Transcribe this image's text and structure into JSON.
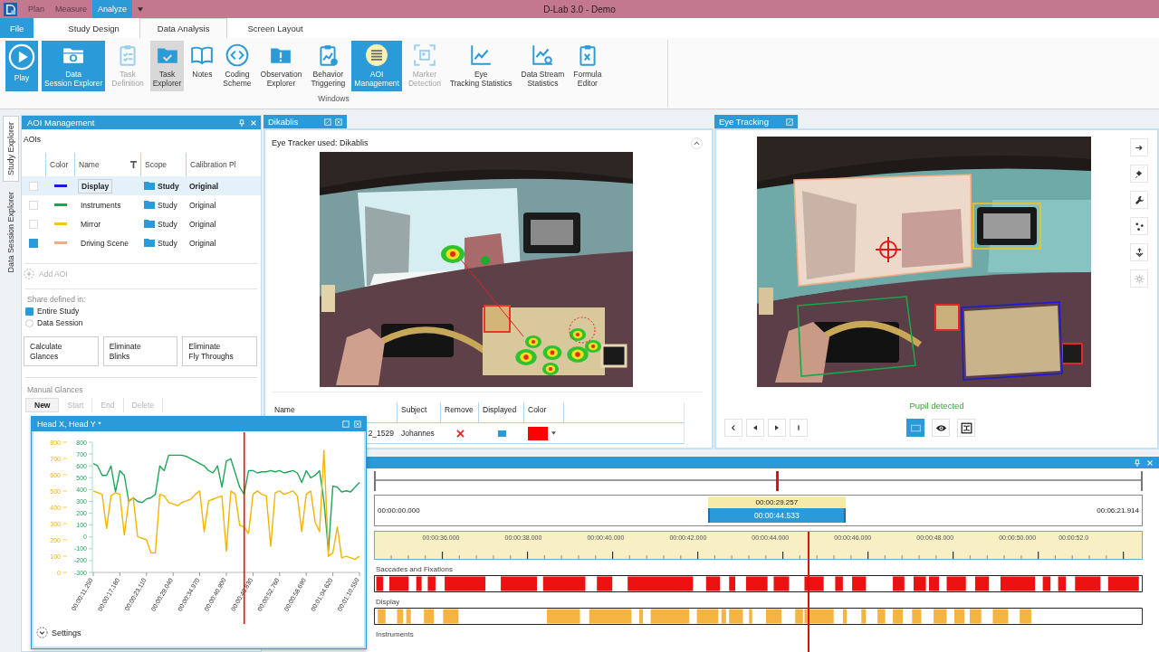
{
  "title_bar": {
    "phases": [
      {
        "label": "Plan",
        "selected": false
      },
      {
        "label": "Measure",
        "selected": false
      },
      {
        "label": "Analyze",
        "selected": true
      }
    ],
    "title": "D-Lab 3.0 - Demo"
  },
  "ribbon_tabs": [
    {
      "label": "File",
      "kind": "file",
      "selected": false
    },
    {
      "label": "Study Design",
      "kind": "tab",
      "selected": false
    },
    {
      "label": "Data Analysis",
      "kind": "tab",
      "selected": true
    },
    {
      "label": "Screen Layout",
      "kind": "tab",
      "selected": false
    }
  ],
  "ribbon": {
    "buttons": [
      {
        "label": "Play",
        "selected": true,
        "pressed": false,
        "disabled": false
      },
      {
        "label": "Data\nSession Explorer",
        "selected": true,
        "pressed": false,
        "disabled": false
      },
      {
        "label": "Task\nDefinition",
        "selected": false,
        "pressed": false,
        "disabled": true
      },
      {
        "label": "Task\nExplorer",
        "selected": false,
        "pressed": true,
        "disabled": false
      },
      {
        "label": "Notes",
        "selected": false,
        "pressed": false,
        "disabled": false
      },
      {
        "label": "Coding\nScheme",
        "selected": false,
        "pressed": false,
        "disabled": false
      },
      {
        "label": "Observation\nExplorer",
        "selected": false,
        "pressed": false,
        "disabled": false
      },
      {
        "label": "Behavior\nTriggering",
        "selected": false,
        "pressed": false,
        "disabled": false
      },
      {
        "label": "AOI\nManagement",
        "selected": true,
        "pressed": false,
        "disabled": false
      },
      {
        "label": "Marker\nDetection",
        "selected": false,
        "pressed": false,
        "disabled": true
      },
      {
        "label": "Eye\nTracking Statistics",
        "selected": false,
        "pressed": false,
        "disabled": false
      },
      {
        "label": "Data Stream\nStatistics",
        "selected": false,
        "pressed": false,
        "disabled": false
      },
      {
        "label": "Formula\nEditor",
        "selected": false,
        "pressed": false,
        "disabled": false
      }
    ],
    "group_label": "Windows"
  },
  "side_tabs": [
    {
      "label": "Study Explorer",
      "selected": true
    },
    {
      "label": "Data Session Explorer",
      "selected": false
    }
  ],
  "aoi_panel": {
    "title": "AOI Management",
    "section_label": "AOIs",
    "columns": [
      "Color",
      "Name",
      "Scope",
      "Calibration Pl"
    ],
    "rows": [
      {
        "checked": false,
        "color": "#1a1adb",
        "name": "Display",
        "scope": "Study",
        "calibration": "Original",
        "selected": true
      },
      {
        "checked": false,
        "color": "#1aa64a",
        "name": "Instruments",
        "scope": "Study",
        "calibration": "Original",
        "selected": false
      },
      {
        "checked": false,
        "color": "#f2c812",
        "name": "Mirror",
        "scope": "Study",
        "calibration": "Original",
        "selected": false
      },
      {
        "checked": true,
        "color": "#f5ac84",
        "name": "Driving Scene",
        "scope": "Study",
        "calibration": "Original",
        "selected": false
      }
    ],
    "add_button": {
      "label": "Add AOI",
      "disabled": true
    },
    "scope_label": "Share defined in:",
    "scope_options": [
      {
        "label": "Entire Study",
        "selected": true
      },
      {
        "label": "Data Session",
        "selected": false
      }
    ],
    "actions": [
      "Calculate\nGlances",
      "Eliminate\nBlinks",
      "Eliminate\nFly Throughs"
    ],
    "manual_label": "Manual Glances",
    "manual_buttons": [
      {
        "label": "New",
        "disabled": false
      },
      {
        "label": "Start",
        "disabled": true
      },
      {
        "label": "End",
        "disabled": true
      },
      {
        "label": "Delete",
        "disabled": true
      }
    ]
  },
  "dikablis_panel": {
    "tab": "Dikablis",
    "eye_tracker_label": "Eye Tracker used: Dikablis",
    "columns": [
      "Name",
      "Subject",
      "Remove",
      "Displayed",
      "Color"
    ],
    "rows": [
      {
        "name": "2_1529",
        "subject": "Johannes",
        "displayed": true,
        "color": "#ff0000"
      }
    ]
  },
  "eye_tracking_panel": {
    "tab": "Eye Tracking",
    "tools": [
      {
        "disabled": false
      },
      {
        "disabled": false
      },
      {
        "disabled": false
      },
      {
        "disabled": false
      },
      {
        "disabled": false
      },
      {
        "disabled": true
      }
    ],
    "pupil_detected": true,
    "status": "Pupil detected",
    "view_buttons": [
      {
        "selected": true
      },
      {
        "selected": false
      },
      {
        "selected": false
      }
    ]
  },
  "chart_window": {
    "title": "Head X, Head Y *",
    "secondary_axis_labels": [
      "800",
      "700",
      "600",
      "500",
      "400",
      "300",
      "200",
      "100",
      "0"
    ],
    "chart_data": {
      "type": "line",
      "categories": [
        "00:00:11.250",
        null,
        null,
        null,
        null,
        null,
        "00:00:17.180",
        null,
        null,
        null,
        null,
        null,
        "00:00:23.110",
        null,
        null,
        null,
        null,
        null,
        "00:00:29.040",
        null,
        null,
        null,
        null,
        null,
        "00:00:34.970",
        null,
        null,
        null,
        null,
        null,
        "00:00:40.900",
        null,
        null,
        null,
        null,
        null,
        "00:00:46.830",
        null,
        null,
        null,
        null,
        null,
        "00:00:52.760",
        null,
        null,
        null,
        null,
        null,
        "00:00:58.690",
        null,
        null,
        null,
        null,
        null,
        "00:01:04.620",
        null,
        null,
        null,
        null,
        null,
        "00:01:10.550"
      ],
      "ylim": [
        -300,
        800
      ],
      "yticks": [
        800,
        700,
        600,
        500,
        400,
        300,
        200,
        100,
        0,
        -100,
        -200,
        -300
      ],
      "series": [
        {
          "color": "#1fa65a",
          "values": [
            620,
            600,
            520,
            520,
            600,
            380,
            560,
            520,
            300,
            330,
            300,
            290,
            320,
            330,
            360,
            600,
            560,
            690,
            690,
            690,
            690,
            680,
            660,
            640,
            620,
            600,
            560,
            540,
            600,
            420,
            640,
            660,
            540,
            420,
            360,
            560,
            560,
            540,
            550,
            550,
            560,
            550,
            560,
            540,
            550,
            560,
            540,
            460,
            560,
            500,
            520,
            560,
            300,
            -120,
            430,
            420,
            380,
            390,
            380,
            420,
            460
          ]
        },
        {
          "color": "#f5b400",
          "values": [
            388,
            374,
            360,
            71,
            346,
            374,
            360,
            16,
            305,
            333,
            3,
            -11,
            -25,
            -135,
            -135,
            360,
            346,
            291,
            278,
            264,
            291,
            305,
            319,
            360,
            388,
            44,
            305,
            319,
            333,
            346,
            -121,
            388,
            360,
            99,
            85,
            30,
            360,
            388,
            360,
            346,
            -80,
            374,
            388,
            360,
            374,
            388,
            346,
            44,
            360,
            388,
            126,
            44,
            731,
            -163,
            -135,
            85,
            -176,
            -163,
            -176,
            -190,
            -163
          ]
        }
      ]
    },
    "settings_label": "Settings"
  },
  "timeline": {
    "overview": {
      "level": 0.524
    },
    "range_start": "00:00:00.000",
    "range_end": "00:06:21.914",
    "window_start": "00:00:29.257",
    "current_time": "00:00:44.533",
    "ruler": {
      "labels": [
        "00:00:36.000",
        "00:00:38.000",
        "00:00:40.000",
        "00:00:42.000",
        "00:00:44.000",
        "00:00:46.000",
        "00:00:48.000",
        "00:00:50.000",
        "00:00:52.0"
      ],
      "level": 0.565
    },
    "tracks": [
      {
        "label": "Saccades and Fixations",
        "color": "#ee1111"
      },
      {
        "label": "Display",
        "color": "#f5b342"
      },
      {
        "label": "Instruments"
      }
    ]
  }
}
